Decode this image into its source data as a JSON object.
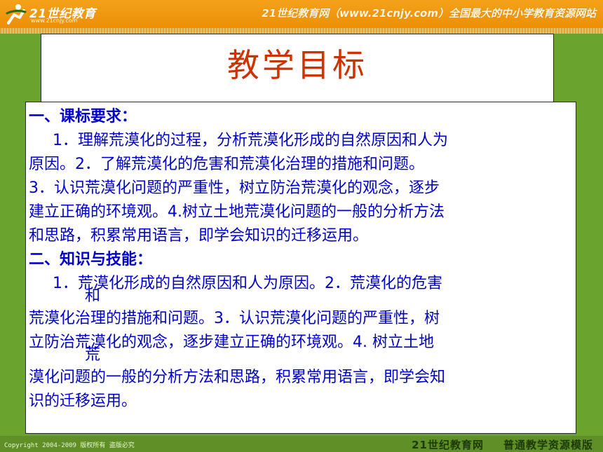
{
  "header": {
    "logo_text": "21世纪教育",
    "logo_url": "www.21cnjy.com",
    "slogan": "21世纪教育网（www.21cnjy.com）全国最大的中小学教育资源网站"
  },
  "slide": {
    "title": "教学目标",
    "lines": [
      "一、课标要求：",
      "1．理解荒漠化的过程，分析荒漠化形成的自然原因和人为",
      "原因。2．了解荒漠化的危害和荒漠化治理的措施和问题。",
      "3．认识荒漠化问题的严重性，树立防治荒漠化的观念，逐步",
      "建立正确的环境观。4.树立土地荒漠化问题的一般的分析方法",
      "和思路，积累常用语言，即学会知识的迁移运用。",
      "二、知识与技能：",
      "1．荒漠化形成的自然原因和人为原因。2．荒漠化的危害",
      "和",
      "荒漠化治理的措施和问题。3．认识荒漠化问题的严重性，树",
      "立防治荒漠化的观念，逐步建立正确的环境观。4. 树立土地",
      "荒",
      "漠化问题的一般的分析方法和思路，积累常用语言，即学会知",
      "识的迁移运用。"
    ]
  },
  "footer": {
    "copyright": "Copyright 2004-2009 版权所有 盗版必究",
    "brand_left": "21世纪教育网",
    "brand_right": "普通教学资源模版"
  },
  "colors": {
    "header": "#ec8f06",
    "background": "#6aa32e",
    "title": "#cc3300",
    "body_text": "#0000cc"
  }
}
